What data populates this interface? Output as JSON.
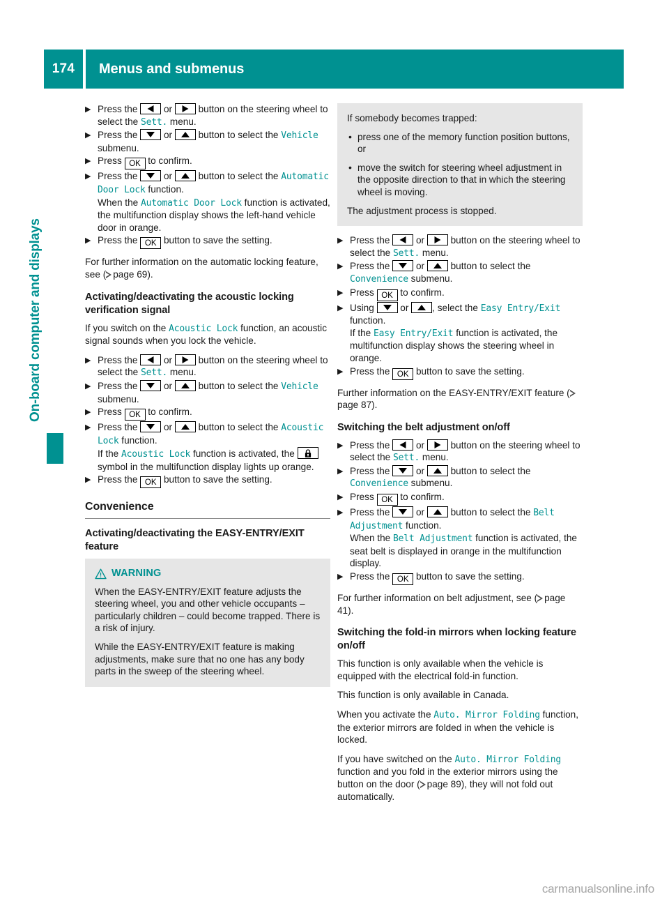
{
  "header": {
    "page_number": "174",
    "title": "Menus and submenus"
  },
  "side_tab": {
    "label": "On-board computer and displays",
    "color": "#009191"
  },
  "watermark": "carmanualsonline.info",
  "icons": {
    "left_arrow": "left-arrow-button",
    "right_arrow": "right-arrow-button",
    "up_arrow": "up-arrow-button",
    "down_arrow": "down-arrow-button",
    "ok": "OK",
    "lock": "lock-symbol",
    "warning": "warning-triangle-icon",
    "page_ref": "page-reference-triangle"
  },
  "left_column": {
    "steps_auto_door_lock": [
      {
        "t1": "Press the ",
        "k1": "left",
        "t2": " or ",
        "k2": "right",
        "t3": " button on the steering wheel to select the ",
        "m1": "Sett.",
        "t4": " menu."
      },
      {
        "t1": "Press the ",
        "k1": "down",
        "t2": " or ",
        "k2": "up",
        "t3": " button to select the ",
        "m1": "Vehicle",
        "t4": " submenu."
      },
      {
        "t1": "Press ",
        "k1": "ok",
        "t2": " to confirm."
      },
      {
        "t1": "Press the ",
        "k1": "down",
        "t2": " or ",
        "k2": "up",
        "t3": " button to select the ",
        "m1": "Automatic Door Lock",
        "t4": " function.",
        "t5": "When the ",
        "m2": "Automatic Door Lock",
        "t6": " function is activated, the multifunction display shows the left-hand vehicle door in orange."
      },
      {
        "t1": "Press the ",
        "k1": "ok",
        "t2": " button to save the setting."
      }
    ],
    "auto_lock_info_pre": "For further information on the automatic locking feature, see (",
    "auto_lock_info_page": "page 69",
    "auto_lock_info_post": ").",
    "acoustic_heading": "Activating/deactivating the acoustic locking verification signal",
    "acoustic_intro_pre": "If you switch on the ",
    "acoustic_intro_mono": "Acoustic Lock",
    "acoustic_intro_post": " function, an acoustic signal sounds when you lock the vehicle.",
    "steps_acoustic": [
      {
        "t1": "Press the ",
        "k1": "left",
        "t2": " or ",
        "k2": "right",
        "t3": " button on the steering wheel to select the ",
        "m1": "Sett.",
        "t4": " menu."
      },
      {
        "t1": "Press the ",
        "k1": "down",
        "t2": " or ",
        "k2": "up",
        "t3": " button to select the ",
        "m1": "Vehicle",
        "t4": " submenu."
      },
      {
        "t1": "Press ",
        "k1": "ok",
        "t2": " to confirm."
      },
      {
        "t1": "Press the ",
        "k1": "down",
        "t2": " or ",
        "k2": "up",
        "t3": " button to select the ",
        "m1": "Acoustic Lock",
        "t4": " function.",
        "t5": "If the ",
        "m2": "Acoustic Lock",
        "t6": " function is activated, the ",
        "k3": "lock",
        "t7": " symbol in the multifunction display lights up orange."
      },
      {
        "t1": "Press the ",
        "k1": "ok",
        "t2": " button to save the setting."
      }
    ],
    "convenience_heading": "Convenience",
    "easy_entry_heading": "Activating/deactivating the EASY-ENTRY/EXIT feature",
    "warning": {
      "label": "WARNING",
      "paragraphs": [
        "When the EASY-ENTRY/EXIT feature adjusts the steering wheel, you and other vehicle occupants – particularly children – could become trapped. There is a risk of injury.",
        "While the EASY-ENTRY/EXIT feature is making adjustments, make sure that no one has any body parts in the sweep of the steering wheel."
      ]
    }
  },
  "right_column": {
    "trapped_box": {
      "intro": "If somebody becomes trapped:",
      "bullets": [
        "press one of the memory function position buttons, or",
        "move the switch for steering wheel adjustment in the opposite direction to that in which the steering wheel is moving."
      ],
      "outro": "The adjustment process is stopped."
    },
    "steps_easy_entry": [
      {
        "t1": "Press the ",
        "k1": "left",
        "t2": " or ",
        "k2": "right",
        "t3": " button on the steering wheel to select the ",
        "m1": "Sett.",
        "t4": " menu."
      },
      {
        "t1": "Press the ",
        "k1": "down",
        "t2": " or ",
        "k2": "up",
        "t3": " button to select the ",
        "m1": "Convenience",
        "t4": " submenu."
      },
      {
        "t1": "Press ",
        "k1": "ok",
        "t2": " to confirm."
      },
      {
        "t1": "Using ",
        "k1": "down",
        "t2": " or ",
        "k2": "up",
        "t3": ", select the ",
        "m1": "Easy Entry/Exit",
        "t4": " function.",
        "t5": "If the ",
        "m2": "Easy Entry/Exit",
        "t6": " function is activated, the multifunction display shows the steering wheel in orange."
      },
      {
        "t1": "Press the ",
        "k1": "ok",
        "t2": " button to save the setting."
      }
    ],
    "easy_entry_info_pre": "Further information on the EASY-ENTRY/EXIT feature (",
    "easy_entry_info_page": "page 87",
    "easy_entry_info_post": ").",
    "belt_heading": "Switching the belt adjustment on/off",
    "steps_belt": [
      {
        "t1": "Press the ",
        "k1": "left",
        "t2": " or ",
        "k2": "right",
        "t3": " button on the steering wheel to select the ",
        "m1": "Sett.",
        "t4": " menu."
      },
      {
        "t1": "Press the ",
        "k1": "down",
        "t2": " or ",
        "k2": "up",
        "t3": " button to select the ",
        "m1": "Convenience",
        "t4": " submenu."
      },
      {
        "t1": "Press ",
        "k1": "ok",
        "t2": " to confirm."
      },
      {
        "t1": "Press the ",
        "k1": "down",
        "t2": " or ",
        "k2": "up",
        "t3": " button to select the ",
        "m1": "Belt Adjustment",
        "t4": " function.",
        "t5": "When the ",
        "m2": "Belt Adjustment",
        "t6": " function is activated, the seat belt is displayed in orange in the multifunction display."
      },
      {
        "t1": "Press the ",
        "k1": "ok",
        "t2": " button to save the setting."
      }
    ],
    "belt_info_pre": "For further information on belt adjustment, see (",
    "belt_info_page": "page 41",
    "belt_info_post": ").",
    "mirrors_heading": "Switching the fold-in mirrors when locking feature on/off",
    "mirrors_p1": "This function is only available when the vehicle is equipped with the electrical fold-in function.",
    "mirrors_p2": "This function is only available in Canada.",
    "mirrors_p3_pre": "When you activate the ",
    "mirrors_p3_mono": "Auto. Mirror Folding",
    "mirrors_p3_post": " function, the exterior mirrors are folded in when the vehicle is locked.",
    "mirrors_p4_pre": "If you have switched on the ",
    "mirrors_p4_mono": "Auto. Mirror Folding",
    "mirrors_p4_mid": " function and you fold in the exterior mirrors using the button on the door (",
    "mirrors_p4_page": "page 89",
    "mirrors_p4_post": "), they will not fold out automatically."
  }
}
